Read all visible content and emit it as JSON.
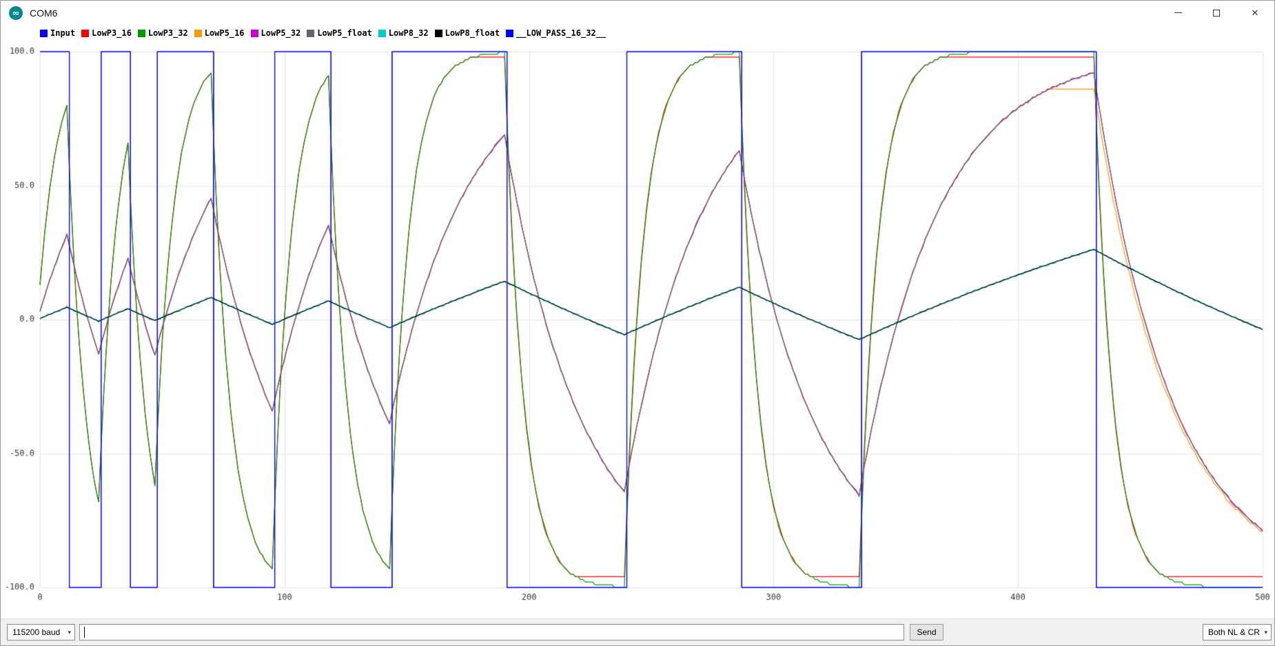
{
  "window": {
    "title": "COM6",
    "icon_glyph": "∞",
    "close_glyph": "✕"
  },
  "serial_bar": {
    "baud_select": {
      "value": "115200 baud"
    },
    "message_input": {
      "value": ""
    },
    "send_button": "Send",
    "line_ending_select": {
      "value": "Both NL & CR"
    },
    "chevron_glyph": "▾"
  },
  "chart_data": {
    "type": "line",
    "title": "",
    "xlabel": "",
    "ylabel": "",
    "x_range": [
      0,
      500
    ],
    "y_range": [
      -100,
      100
    ],
    "grid": true,
    "legend_position": "top-left",
    "samples": 500,
    "x_ticks": [
      {
        "value": 0,
        "label": "0"
      },
      {
        "value": 100,
        "label": "100"
      },
      {
        "value": 200,
        "label": "200"
      },
      {
        "value": 300,
        "label": "300"
      },
      {
        "value": 400,
        "label": "400"
      },
      {
        "value": 500,
        "label": "500"
      }
    ],
    "y_ticks": [
      {
        "value": 100,
        "label": "100.0"
      },
      {
        "value": 50,
        "label": "50.0"
      },
      {
        "value": 0,
        "label": "0.0"
      },
      {
        "value": -50,
        "label": "-50.0"
      },
      {
        "value": -100,
        "label": "-100.0"
      }
    ],
    "input_square_wave": {
      "high": 100,
      "low": -100,
      "transitions": [
        0,
        12,
        25,
        37,
        48,
        71,
        96,
        119,
        144,
        191,
        240,
        287,
        336,
        432
      ]
    },
    "series": [
      {
        "label": "Input",
        "color": "#0000ff",
        "kind": "square-input"
      },
      {
        "label": "LowP3_16",
        "color": "#ff0000",
        "kind": "lowpass",
        "alpha": 0.125,
        "quantize": 1,
        "clamp": [
          -96.5,
          97.5
        ]
      },
      {
        "label": "LowP3_32",
        "color": "#009900",
        "kind": "lowpass",
        "alpha": 0.125,
        "quantize": 1
      },
      {
        "label": "LowP5_16",
        "color": "#ff9900",
        "kind": "lowpass",
        "alpha": 0.03125,
        "quantize": 1,
        "clamp": [
          -100,
          86
        ]
      },
      {
        "label": "LowP5_32",
        "color": "#cc00cc",
        "kind": "lowpass",
        "alpha": 0.03125,
        "quantize": 1
      },
      {
        "label": "LowP5_float",
        "color": "#666666",
        "kind": "lowpass",
        "alpha": 0.03125
      },
      {
        "label": "LowP8_32",
        "color": "#00cccc",
        "kind": "lowpass",
        "alpha": 0.00390625,
        "quantize": 1
      },
      {
        "label": "LowP8_float",
        "color": "#000000",
        "kind": "lowpass",
        "alpha": 0.00390625
      },
      {
        "label": "__LOW_PASS_16_32__",
        "color": "#0000ff",
        "kind": "square-input"
      }
    ]
  }
}
